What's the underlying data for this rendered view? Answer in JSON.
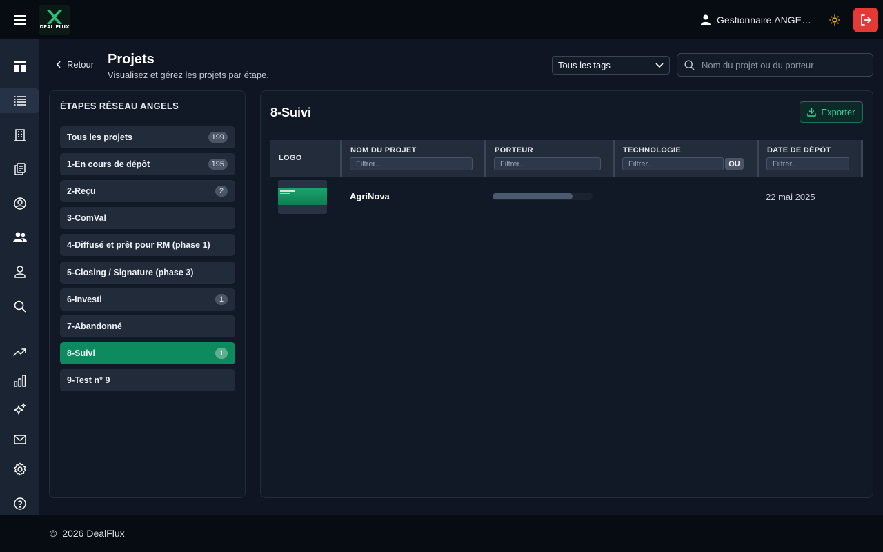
{
  "app": {
    "logo_text": "DEAL FLUX",
    "user_name": "Gestionnaire.ANGE…",
    "footer": "2026 DealFlux",
    "footer_symbol": "©"
  },
  "sidebar": {
    "items": [
      {
        "icon": "dashboard-icon",
        "active": false
      },
      {
        "icon": "list-icon",
        "active": true
      },
      {
        "icon": "building-icon",
        "active": false
      },
      {
        "icon": "documents-icon",
        "active": false
      },
      {
        "icon": "user-circle-icon",
        "active": false
      },
      {
        "icon": "users-icon",
        "active": false
      },
      {
        "icon": "person-icon",
        "active": false
      },
      {
        "icon": "search-icon",
        "active": false
      },
      {
        "icon": "trending-up-icon",
        "active": false
      },
      {
        "icon": "bar-chart-icon",
        "active": false
      },
      {
        "icon": "sparkles-icon",
        "active": false
      },
      {
        "icon": "mail-icon",
        "active": false
      },
      {
        "icon": "settings-icon",
        "active": false
      },
      {
        "icon": "help-icon",
        "active": false
      }
    ]
  },
  "header": {
    "back_label": "Retour",
    "title": "Projets",
    "subtitle": "Visualisez et gérez les projets par étape.",
    "tags_select": "Tous les tags",
    "search_placeholder": "Nom du projet ou du porteur"
  },
  "stages": {
    "title": "ÉTAPES RÉSEAU ANGELS",
    "items": [
      {
        "label": "Tous les projets",
        "count": "199",
        "active": false
      },
      {
        "label": "1-En cours de dépôt",
        "count": "195",
        "active": false
      },
      {
        "label": "2-Reçu",
        "count": "2",
        "active": false
      },
      {
        "label": "3-ComVal",
        "count": "",
        "active": false
      },
      {
        "label": "4-Diffusé et prêt pour RM (phase 1)",
        "count": "",
        "active": false
      },
      {
        "label": "5-Closing / Signature (phase 3)",
        "count": "",
        "active": false
      },
      {
        "label": "6-Investi",
        "count": "1",
        "active": false
      },
      {
        "label": "7-Abandonné",
        "count": "",
        "active": false
      },
      {
        "label": "8-Suivi",
        "count": "1",
        "active": true
      },
      {
        "label": "9-Test n° 9",
        "count": "",
        "active": false
      }
    ]
  },
  "main": {
    "stage_title": "8-Suivi",
    "export_label": "Exporter",
    "columns": {
      "logo": "LOGO",
      "name": "NOM DU PROJET",
      "porteur": "PORTEUR",
      "technologie": "TECHNOLOGIE",
      "date": "DATE DE DÉPÔT"
    },
    "filter_placeholder": "Filtrer...",
    "ou_label": "OU",
    "rows": [
      {
        "name": "AgriNova",
        "porteur_progress": 0.8,
        "date": "22 mai 2025"
      }
    ]
  },
  "colors": {
    "accent": "#0e8a5f",
    "accent_text": "#35d39b",
    "danger": "#e53935",
    "background": "#0f1522",
    "panel": "#111826"
  }
}
